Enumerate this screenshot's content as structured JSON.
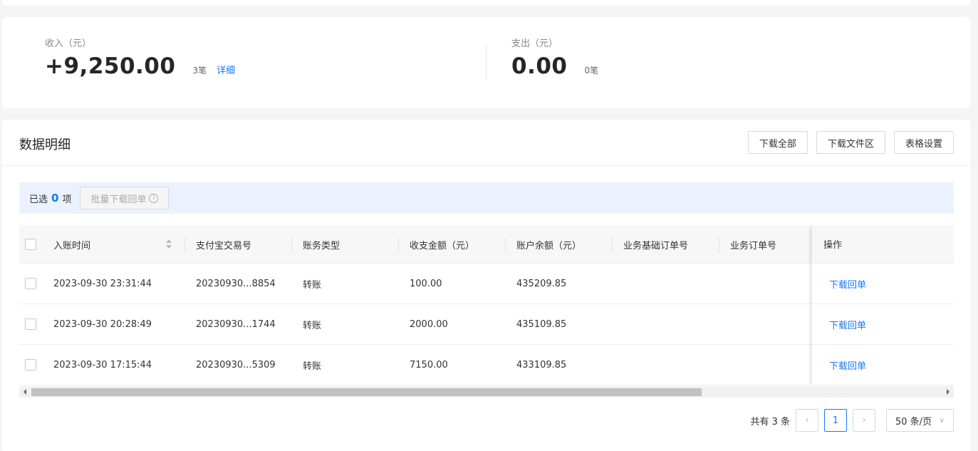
{
  "summary": {
    "income": {
      "label": "收入（元）",
      "amount": "+9,250.00",
      "count": "3笔",
      "link": "详细"
    },
    "expense": {
      "label": "支出（元）",
      "amount": "0.00",
      "count": "0笔"
    }
  },
  "detail": {
    "title": "数据明细",
    "buttons": {
      "download_all": "下载全部",
      "download_files": "下载文件区",
      "table_settings": "表格设置"
    }
  },
  "selection": {
    "prefix": "已选",
    "count": "0",
    "suffix": "项",
    "batch_button": "批量下载回单"
  },
  "table": {
    "columns": [
      "入账时间",
      "支付宝交易号",
      "账务类型",
      "收支金额（元）",
      "账户余额（元）",
      "业务基础订单号",
      "业务订单号"
    ],
    "action_column": "操作",
    "rows": [
      {
        "time": "2023-09-30 23:31:44",
        "trade_no": "20230930...8854",
        "type": "转账",
        "amount": "100.00",
        "balance": "435209.85",
        "base_order": "",
        "order": "",
        "action": "下载回单"
      },
      {
        "time": "2023-09-30 20:28:49",
        "trade_no": "20230930...1744",
        "type": "转账",
        "amount": "2000.00",
        "balance": "435109.85",
        "base_order": "",
        "order": "",
        "action": "下载回单"
      },
      {
        "time": "2023-09-30 17:15:44",
        "trade_no": "20230930...5309",
        "type": "转账",
        "amount": "7150.00",
        "balance": "433109.85",
        "base_order": "",
        "order": "",
        "action": "下载回单"
      }
    ]
  },
  "pagination": {
    "total": "共有 3 条",
    "prev": "‹",
    "current": "1",
    "next": "›",
    "page_size": "50 条/页",
    "chevron": "∨"
  }
}
